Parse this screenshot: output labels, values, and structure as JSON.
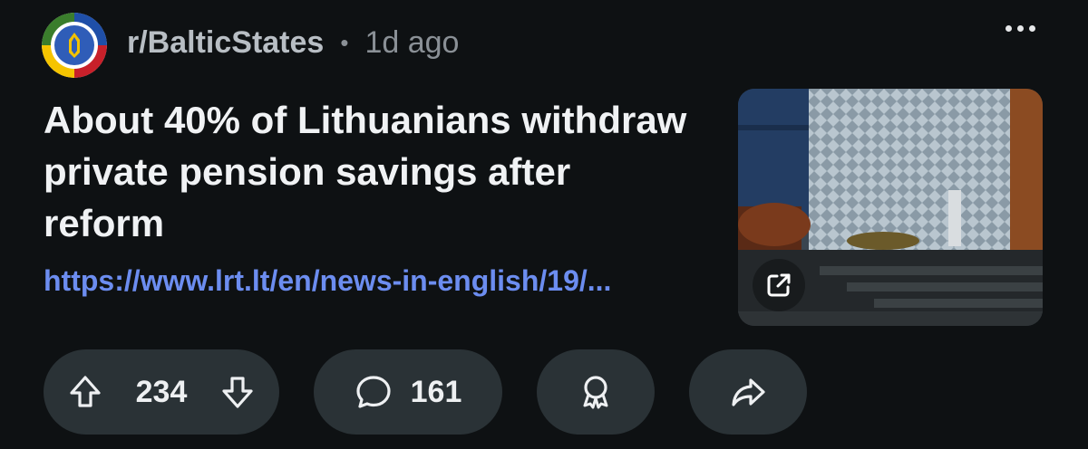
{
  "post": {
    "subreddit": "r/BalticStates",
    "separator": "•",
    "time": "1d ago",
    "title": "About 40% of Lithuanians withdraw private pension savings after reform",
    "link_text": "https://www.lrt.lt/en/news-in-english/19/...",
    "upvotes": "234",
    "comments": "161"
  },
  "icons": {
    "avatar": "subreddit-avatar",
    "more": "more-options-icon",
    "external": "external-link-icon",
    "upvote": "arrow-up-icon",
    "downvote": "arrow-down-icon",
    "comment": "comment-bubble-icon",
    "award": "award-icon",
    "share": "share-arrow-icon"
  },
  "colors": {
    "background": "#0e1113",
    "link": "#6c8df0",
    "pill": "#2a3236"
  }
}
